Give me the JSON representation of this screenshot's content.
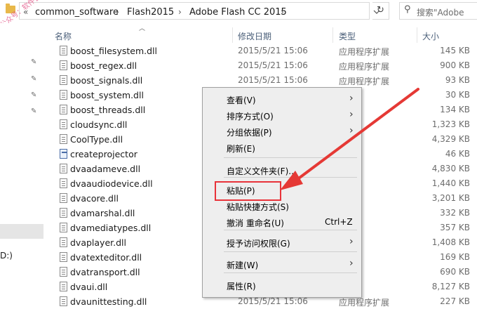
{
  "address": {
    "nav_back": "«",
    "crumbs": [
      "common_software",
      "Flash2015",
      "Adobe Flash CC 2015"
    ],
    "separator": "›",
    "search_placeholder": "搜索\"Adobe"
  },
  "watermark": "公众号：软件管家",
  "columns": {
    "name": "名称",
    "date": "修改日期",
    "type": "类型",
    "size": "大小"
  },
  "nav": {
    "drive_label": "D:)"
  },
  "files": [
    {
      "name": "boost_filesystem.dll",
      "date": "2015/5/21 15:06",
      "type": "应用程序扩展",
      "size": "145 KB",
      "icon": "dll-file-icon"
    },
    {
      "name": "boost_regex.dll",
      "date": "2015/5/21 15:06",
      "type": "应用程序扩展",
      "size": "900 KB",
      "icon": "dll-file-icon"
    },
    {
      "name": "boost_signals.dll",
      "date": "2015/5/21 15:06",
      "type": "应用程序扩展",
      "size": "93 KB",
      "icon": "dll-file-icon"
    },
    {
      "name": "boost_system.dll",
      "date": "",
      "type": "",
      "size": "30 KB",
      "icon": "dll-file-icon"
    },
    {
      "name": "boost_threads.dll",
      "date": "",
      "type": "",
      "size": "134 KB",
      "icon": "dll-file-icon"
    },
    {
      "name": "cloudsync.dll",
      "date": "",
      "type": "",
      "size": "1,323 KB",
      "icon": "dll-file-icon"
    },
    {
      "name": "CoolType.dll",
      "date": "",
      "type": "",
      "size": "4,329 KB",
      "icon": "dll-file-icon"
    },
    {
      "name": "createprojector",
      "date": "",
      "type": "序",
      "size": "46 KB",
      "icon": "exe-file-icon"
    },
    {
      "name": "dvaadameve.dll",
      "date": "",
      "type": "",
      "size": "4,830 KB",
      "icon": "dll-file-icon"
    },
    {
      "name": "dvaaudiodevice.dll",
      "date": "",
      "type": "",
      "size": "1,440 KB",
      "icon": "dll-file-icon"
    },
    {
      "name": "dvacore.dll",
      "date": "",
      "type": "",
      "size": "3,201 KB",
      "icon": "dll-file-icon"
    },
    {
      "name": "dvamarshal.dll",
      "date": "",
      "type": "",
      "size": "332 KB",
      "icon": "dll-file-icon"
    },
    {
      "name": "dvamediatypes.dll",
      "date": "",
      "type": "",
      "size": "357 KB",
      "icon": "dll-file-icon"
    },
    {
      "name": "dvaplayer.dll",
      "date": "",
      "type": "",
      "size": "1,408 KB",
      "icon": "dll-file-icon"
    },
    {
      "name": "dvatexteditor.dll",
      "date": "",
      "type": "",
      "size": "169 KB",
      "icon": "dll-file-icon"
    },
    {
      "name": "dvatransport.dll",
      "date": "",
      "type": "",
      "size": "690 KB",
      "icon": "dll-file-icon"
    },
    {
      "name": "dvaui.dll",
      "date": "",
      "type": "",
      "size": "8,127 KB",
      "icon": "dll-file-icon"
    },
    {
      "name": "dvaunittesting.dll",
      "date": "2015/5/21 15:06",
      "type": "应用程序扩展",
      "size": "227 KB",
      "icon": "dll-file-icon"
    }
  ],
  "context_menu": {
    "items": [
      {
        "label": "查看(V)",
        "submenu": true,
        "shortcut": ""
      },
      {
        "label": "排序方式(O)",
        "submenu": true,
        "shortcut": ""
      },
      {
        "label": "分组依据(P)",
        "submenu": true,
        "shortcut": ""
      },
      {
        "label": "刷新(E)",
        "submenu": false,
        "shortcut": ""
      },
      {
        "label": "自定义文件夹(F)...",
        "submenu": false,
        "shortcut": ""
      },
      {
        "label": "粘贴(P)",
        "submenu": false,
        "shortcut": ""
      },
      {
        "label": "粘贴快捷方式(S)",
        "submenu": false,
        "shortcut": ""
      },
      {
        "label": "撤消 重命名(U)",
        "submenu": false,
        "shortcut": "Ctrl+Z"
      },
      {
        "label": "授予访问权限(G)",
        "submenu": true,
        "shortcut": ""
      },
      {
        "label": "新建(W)",
        "submenu": true,
        "shortcut": ""
      },
      {
        "label": "属性(R)",
        "submenu": false,
        "shortcut": ""
      }
    ]
  },
  "colors": {
    "highlight": "#e8333a",
    "arrow": "#e53935",
    "header_text": "#4c607a"
  }
}
